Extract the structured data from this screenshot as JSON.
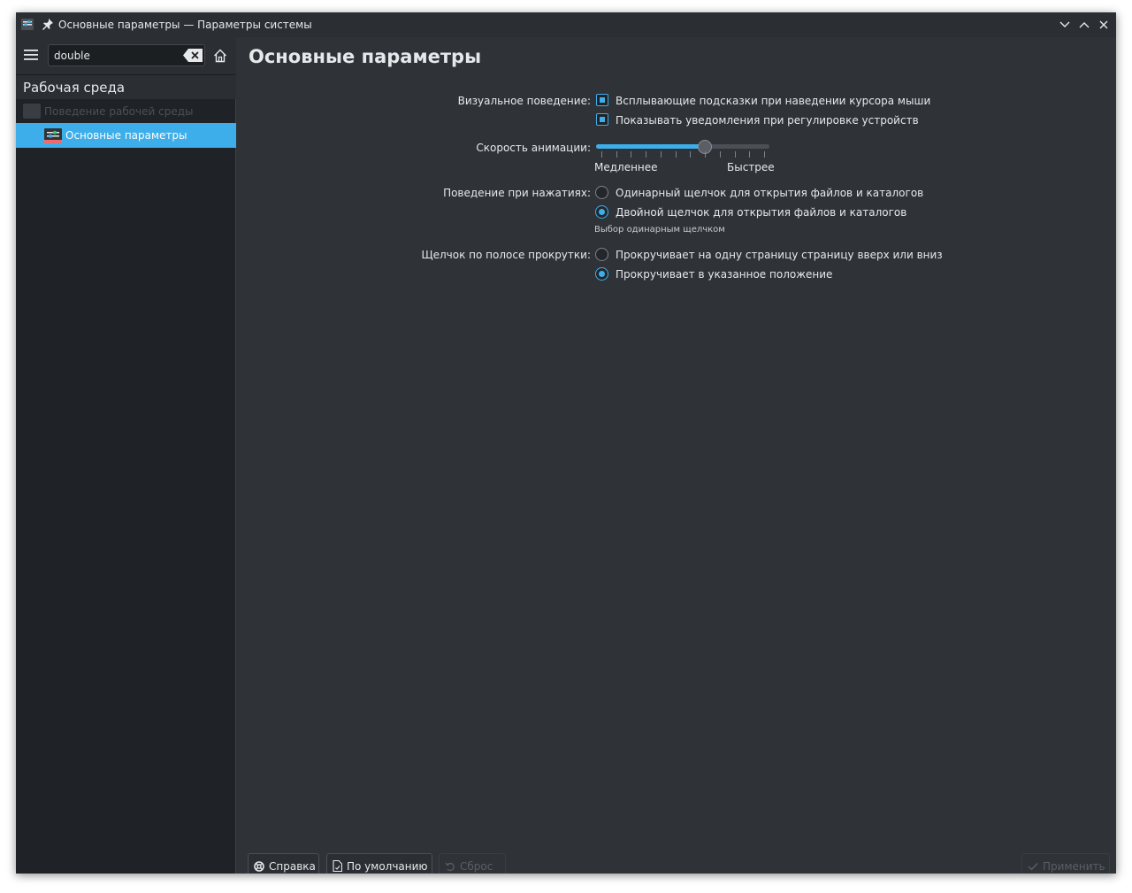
{
  "window": {
    "title": "Основные параметры — Параметры системы"
  },
  "sidebar": {
    "search": {
      "value": "double",
      "placeholder": ""
    },
    "section_title": "Рабочая среда",
    "items": [
      {
        "label": "Поведение рабочей среды",
        "state": "disabled"
      },
      {
        "label": "Основные параметры",
        "state": "selected"
      }
    ]
  },
  "main": {
    "page_title": "Основные параметры",
    "visual": {
      "label": "Визуальное поведение:",
      "options": [
        {
          "text": "Всплывающие подсказки при наведении курсора мыши",
          "checked": true
        },
        {
          "text": "Показывать уведомления при регулировке устройств",
          "checked": true
        }
      ]
    },
    "animation": {
      "label": "Скорость анимации:",
      "min_label": "Медленнее",
      "max_label": "Быстрее",
      "ticks": 12,
      "position": 7
    },
    "click": {
      "label": "Поведение при нажатиях:",
      "options": [
        {
          "text": "Одинарный щелчок для открытия файлов и каталогов",
          "selected": false
        },
        {
          "text": "Двойной щелчок для открытия файлов и каталогов",
          "selected": true
        }
      ],
      "hint": "Выбор одинарным щелчком"
    },
    "scrollbar": {
      "label": "Щелчок по полосе прокрутки:",
      "options": [
        {
          "text": "Прокручивает на одну страницу страницу вверх или вниз",
          "selected": false
        },
        {
          "text": "Прокручивает в указанное положение",
          "selected": true
        }
      ]
    }
  },
  "footer": {
    "help": "Справка",
    "defaults": "По умолчанию",
    "reset": "Сброс",
    "apply": "Применить"
  },
  "colors": {
    "accent": "#3daee9",
    "window_bg": "#2f3338",
    "sidebar_bg": "#1f2226"
  }
}
